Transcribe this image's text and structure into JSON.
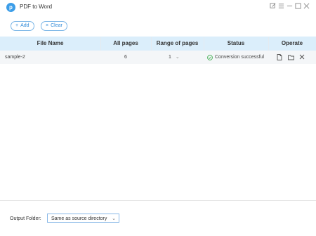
{
  "window": {
    "title": "PDF to Word",
    "logo_letter": "p"
  },
  "toolbar": {
    "add_label": "Add",
    "clear_label": "Clear"
  },
  "table": {
    "headers": [
      "File Name",
      "All pages",
      "Range of pages",
      "Status",
      "Operate"
    ],
    "rows": [
      {
        "file_name": "sample-2",
        "all_pages": "6",
        "range": "1",
        "status": "Conversion successful"
      }
    ]
  },
  "footer": {
    "output_label": "Output Folder:",
    "output_value": "Same as source directory"
  },
  "colors": {
    "accent": "#2f8ad8",
    "header_bg": "#dbeefb",
    "success": "#3aab4a"
  }
}
